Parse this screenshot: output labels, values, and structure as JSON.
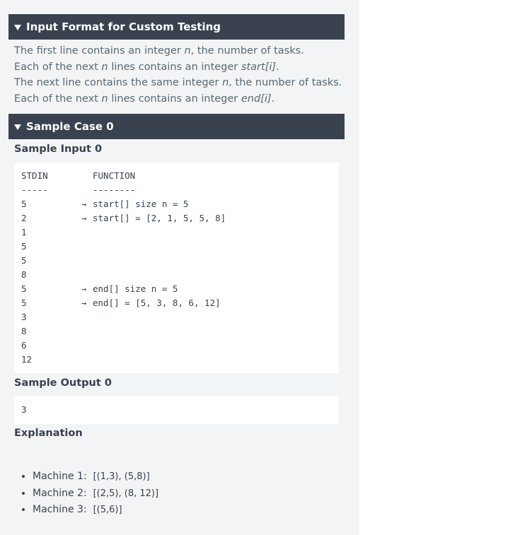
{
  "sections": {
    "input_format": {
      "title": "Input Format for Custom Testing",
      "lines": [
        {
          "pre": "The first line contains an integer ",
          "em": "n",
          "post": ", the number of tasks."
        },
        {
          "pre": "Each of the next ",
          "em": "n",
          "post": " lines contains an integer ",
          "em2": "start[i]",
          "post2": "."
        },
        {
          "pre": "The next line contains the same integer ",
          "em": "n",
          "post": ", the number of tasks."
        },
        {
          "pre": "Each of the next ",
          "em": "n",
          "post": " lines contains an integer ",
          "em2": "end[i]",
          "post2": "."
        }
      ]
    },
    "sample_case": {
      "title": "Sample Case 0",
      "input_heading": "Sample Input 0",
      "stdin_header": "STDIN",
      "function_header": "FUNCTION",
      "stdin_rule": "-----",
      "function_rule": "--------",
      "rows": [
        {
          "stdin": "5",
          "arrow": "→",
          "fn": "start[] size n = 5"
        },
        {
          "stdin": "2",
          "arrow": "→",
          "fn": "start[] = [2, 1, 5, 5, 8]"
        },
        {
          "stdin": "1",
          "arrow": "",
          "fn": ""
        },
        {
          "stdin": "5",
          "arrow": "",
          "fn": ""
        },
        {
          "stdin": "5",
          "arrow": "",
          "fn": ""
        },
        {
          "stdin": "8",
          "arrow": "",
          "fn": ""
        },
        {
          "stdin": "5",
          "arrow": "→",
          "fn": "end[] size n = 5"
        },
        {
          "stdin": "5",
          "arrow": "→",
          "fn": "end[] = [5, 3, 8, 6, 12]"
        },
        {
          "stdin": "3",
          "arrow": "",
          "fn": ""
        },
        {
          "stdin": "8",
          "arrow": "",
          "fn": ""
        },
        {
          "stdin": "6",
          "arrow": "",
          "fn": ""
        },
        {
          "stdin": "12",
          "arrow": "",
          "fn": ""
        }
      ],
      "output_heading": "Sample Output 0",
      "output_value": "3",
      "explanation_heading": "Explanation",
      "machines": [
        {
          "label": "Machine 1:",
          "value": "[(1,3), (5,8)]"
        },
        {
          "label": "Machine 2:",
          "value": "[(2,5), (8, 12)]"
        },
        {
          "label": "Machine 3:",
          "value": "[(5,6)]"
        }
      ]
    }
  }
}
